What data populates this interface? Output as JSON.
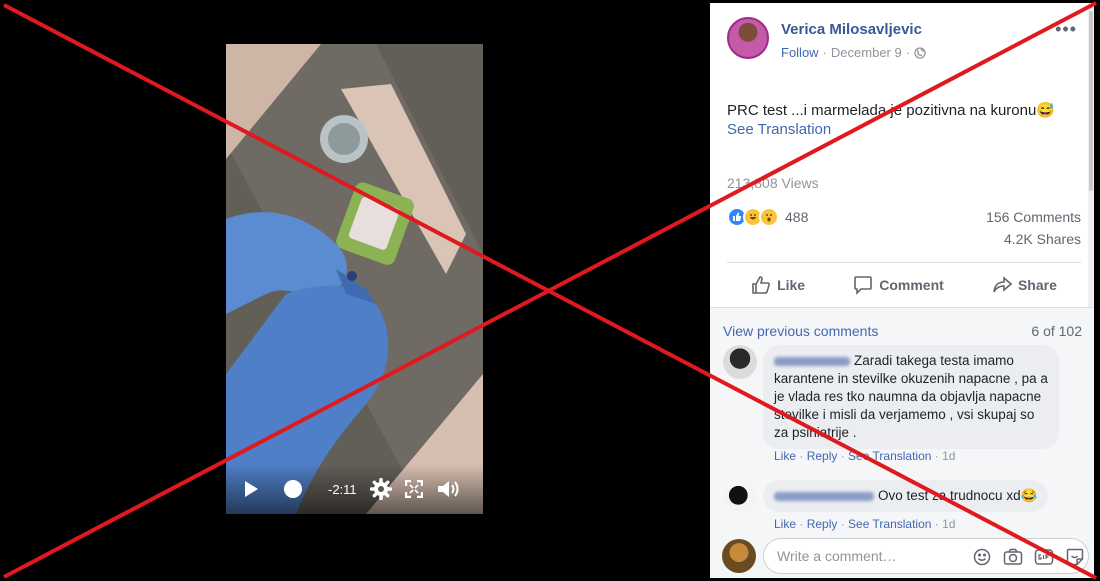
{
  "video": {
    "time_remaining": "-2:11"
  },
  "post": {
    "author": "Verica Milosavljevic",
    "follow_label": "Follow",
    "date": "December 9",
    "more_label": "•••",
    "text": "PRC test ...i marmelada je pozitivna na kuronu😅",
    "see_translation": "See Translation",
    "views": "213,808 Views",
    "reaction_count": "488",
    "comments_count": "156 Comments",
    "shares_count": "4.2K Shares",
    "actions": {
      "like": "Like",
      "comment": "Comment",
      "share": "Share"
    }
  },
  "comments": {
    "view_previous": "View previous comments",
    "page_count": "6 of 102",
    "items": [
      {
        "text": "Zaradi takega testa imamo karantene in stevilke okuzenih napacne , pa a je vlada res tko naumna da objavlja napacne stevilke i misli da verjamemo , vsi skupaj so za psihiatrije .",
        "like": "Like",
        "reply": "Reply",
        "see_translation": "See Translation",
        "age": "1d"
      },
      {
        "text": "Ovo test za trudnocu xd😂",
        "like": "Like",
        "reply": "Reply",
        "see_translation": "See Translation",
        "age": "1d"
      }
    ],
    "write_placeholder": "Write a comment…"
  },
  "colors": {
    "link": "#4267b2",
    "author": "#385898",
    "overlay_red": "#e0191f"
  }
}
